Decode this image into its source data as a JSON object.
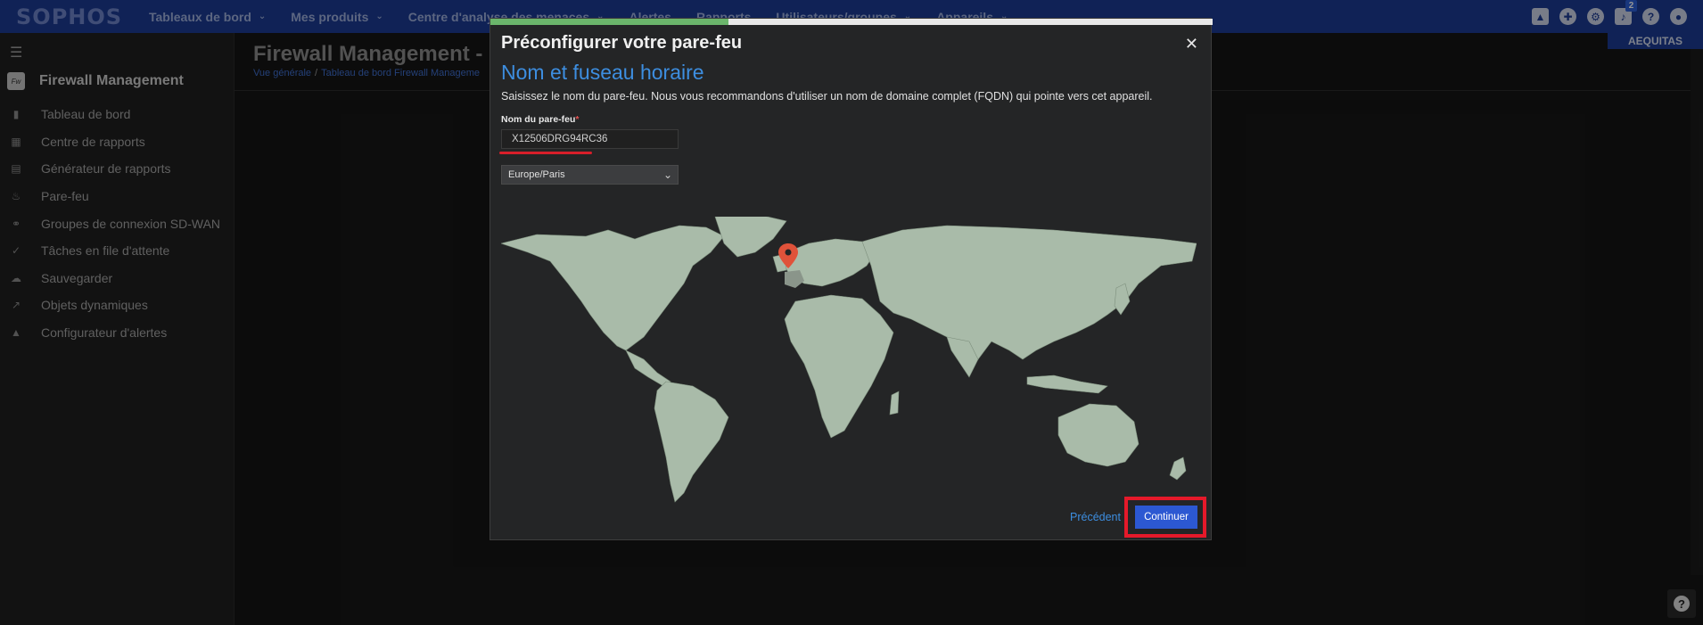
{
  "topnav": {
    "logo": "SOPHOS",
    "items": [
      {
        "label": "Tableaux de bord",
        "chevron": true
      },
      {
        "label": "Mes produits",
        "chevron": true
      },
      {
        "label": "Centre d'analyse des menaces",
        "chevron": true
      },
      {
        "label": "Alertes",
        "chevron": false
      },
      {
        "label": "Rapports",
        "chevron": false
      },
      {
        "label": "Utilisateurs/groupes",
        "chevron": true
      },
      {
        "label": "Appareils",
        "chevron": true
      }
    ],
    "notification_count": "2",
    "account_name": "AEQUITAS",
    "icons": [
      "graduation-cap-icon",
      "status-icon",
      "gear-icon",
      "bell-icon",
      "help-icon",
      "user-icon"
    ]
  },
  "sidebar": {
    "title": "Firewall Management",
    "logo_text": "Fw",
    "items": [
      {
        "label": "Tableau de bord",
        "icon": "bar-chart-icon"
      },
      {
        "label": "Centre de rapports",
        "icon": "grid-icon"
      },
      {
        "label": "Générateur de rapports",
        "icon": "clipboard-icon"
      },
      {
        "label": "Pare-feu",
        "icon": "flame-icon"
      },
      {
        "label": "Groupes de connexion SD-WAN",
        "icon": "network-icon"
      },
      {
        "label": "Tâches en file d'attente",
        "icon": "check-circle-icon"
      },
      {
        "label": "Sauvegarder",
        "icon": "cloud-icon"
      },
      {
        "label": "Objets dynamiques",
        "icon": "trend-icon"
      },
      {
        "label": "Configurateur d'alertes",
        "icon": "warning-icon"
      }
    ]
  },
  "main": {
    "title": "Firewall Management -",
    "breadcrumb": [
      "Vue générale",
      "Tableau de bord Firewall Manageme"
    ]
  },
  "modal": {
    "title": "Préconfigurer votre pare-feu",
    "step_progress": 0.33,
    "section_title": "Nom et fuseau horaire",
    "intro": "Saisissez le nom du pare-feu. Nous vous recommandons d'utiliser un nom de domaine complet (FQDN) qui pointe vers cet appareil.",
    "name_label": "Nom du pare-feu",
    "required_mark": "*",
    "name_value": "X12506DRG94RC36",
    "timezone": "Europe/Paris",
    "prev_label": "Précédent",
    "continue_label": "Continuer",
    "colors": {
      "accent_blue": "#3d8ee0",
      "button_blue": "#2c58d2",
      "highlight_red": "#e5192a",
      "map_land": "#a9bba9",
      "marker": "#e0523a"
    }
  }
}
